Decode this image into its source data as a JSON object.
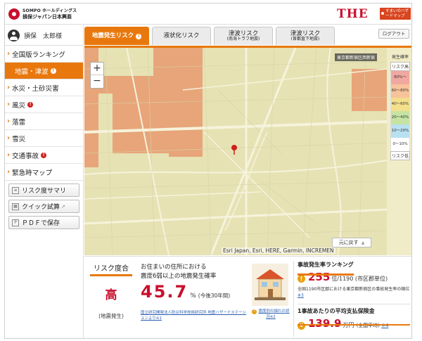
{
  "header": {
    "logo_top": "SOMPO ホールディングス",
    "logo_bottom": "損保ジャパン日本興亜",
    "the_logo": "THE",
    "hazard_badge": "すまいのハザードマップ"
  },
  "sidebar": {
    "user_name": "損保　太郎様",
    "items": [
      {
        "label": "全国版ランキング",
        "warn": ""
      },
      {
        "label": "地震・津波",
        "warn": "!"
      },
      {
        "label": "水災・土砂災害",
        "warn": ""
      },
      {
        "label": "風災",
        "warn": "!"
      },
      {
        "label": "落雷",
        "warn": ""
      },
      {
        "label": "雪災",
        "warn": ""
      },
      {
        "label": "交通事故",
        "warn": "!"
      },
      {
        "label": "緊急時マップ",
        "warn": ""
      }
    ],
    "buttons": [
      {
        "label": "リスク度サマリ",
        "ext": ""
      },
      {
        "label": "クイック試算",
        "ext": "↗"
      },
      {
        "label": "ＰＤＦで保存",
        "ext": ""
      }
    ]
  },
  "tabs": [
    {
      "label": "地震発生リスク",
      "sub": "",
      "warn": "!"
    },
    {
      "label": "液状化リスク",
      "sub": "",
      "warn": ""
    },
    {
      "label": "津波リスク",
      "sub": "(南海トラフ地震)",
      "warn": ""
    },
    {
      "label": "津波リスク",
      "sub": "(首都直下地震)",
      "warn": ""
    }
  ],
  "logout_label": "ログアウト",
  "map": {
    "area_label": "東京都新宿区西新宿",
    "attribution": "Esri Japan, Esri, HERE, Garmin, INCREMEN",
    "reset_label": "元に戻す",
    "reset_icon": "▲",
    "zoom_in": "+",
    "zoom_out": "−",
    "colors": {
      "low": "#e6e2b4",
      "high": "#e8a074"
    }
  },
  "legend": {
    "title": "発生確率",
    "high_label": "リスク高",
    "low_label": "リスク低",
    "bands": [
      {
        "label": "80%〜",
        "color": "#f0a8a0"
      },
      {
        "label": "60〜80%",
        "color": "#f7c39b"
      },
      {
        "label": "40〜60%",
        "color": "#f3df8c"
      },
      {
        "label": "20〜40%",
        "color": "#c6e3a3"
      },
      {
        "label": "10〜20%",
        "color": "#b9e0f0"
      },
      {
        "label": "0〜10%",
        "color": "#ffffff"
      }
    ]
  },
  "risk": {
    "title": "リスク度合",
    "level": "高",
    "sub": "(地震発生)"
  },
  "probability": {
    "line1": "お住まいの住所における",
    "line2": "震度6弱以上の地震発生確率",
    "value": "45.7",
    "unit": "%",
    "note": "(今後30年間)",
    "source": "国立研究開発法人防災科学技術研究所 地震ハザードステーションより※1"
  },
  "house": {
    "caption": "震度別の揺れの状況※2",
    "q": "?"
  },
  "accident": {
    "title": "事故発生率ランキング",
    "rank": "255",
    "rank_denominator": "位/1190 (市区郡単位)",
    "desc": "全国1190市区郡における東京都新宿区の事故発生率の順位",
    "desc_link": "※3",
    "premium_title": "1事故あたりの平均支払保険金",
    "premium_value": "139.9",
    "premium_unit": "万円",
    "premium_note": "(全国平均)",
    "premium_link": "※4"
  }
}
